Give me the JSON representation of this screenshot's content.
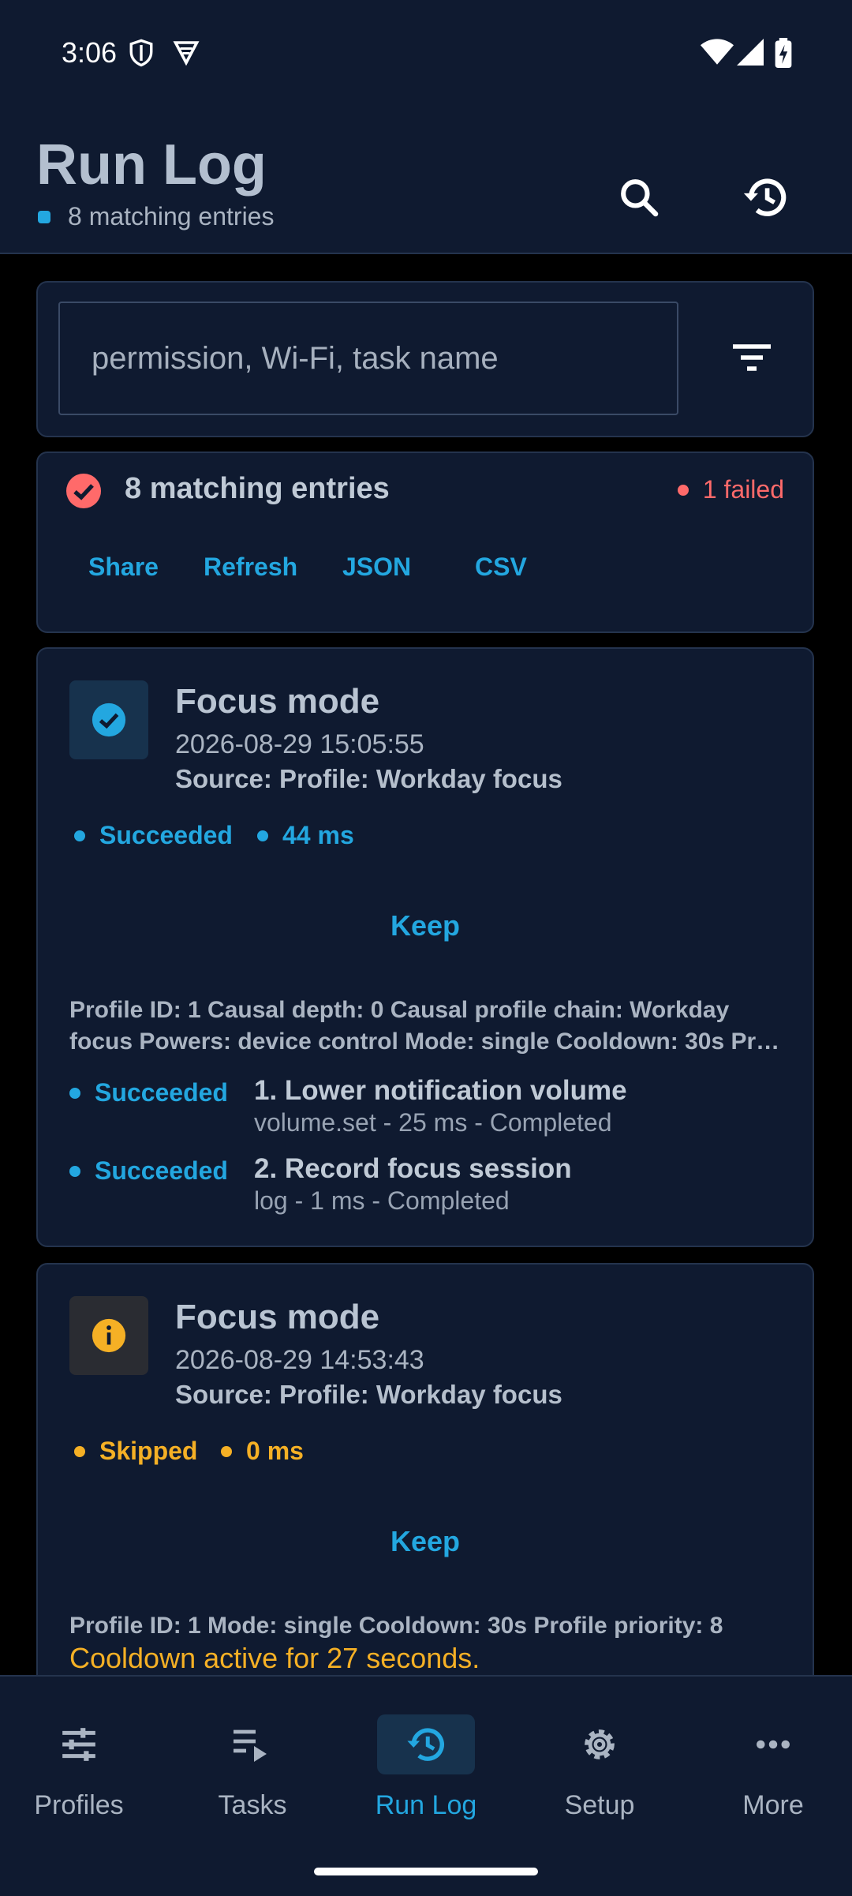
{
  "status_bar": {
    "time": "3:06",
    "icons": [
      "shield-icon",
      "vpn-icon",
      "wifi-icon",
      "signal-icon",
      "battery-icon"
    ]
  },
  "app_bar": {
    "title": "Run Log",
    "subtitle": "8 matching entries",
    "actions": [
      "search-icon",
      "history-icon"
    ]
  },
  "search": {
    "placeholder": "permission, Wi-Fi, task name",
    "value": ""
  },
  "summary": {
    "title": "8 matching entries",
    "failed": "1 failed",
    "actions": [
      "Share",
      "Refresh",
      "JSON",
      "CSV"
    ]
  },
  "entries": [
    {
      "title": "Focus mode",
      "datetime": "2026-08-29 15:05:55",
      "source": "Source: Profile: Workday focus",
      "status": "Succeeded",
      "duration": "44 ms",
      "keep_label": "Keep",
      "details_line1": "Profile ID: 1  Causal depth: 0  Causal profile chain: Workday",
      "details_line2": "focus  Powers: device control  Mode: single  Cooldown: 30s  Pr…",
      "steps": [
        {
          "status": "Succeeded",
          "title": "1. Lower notification volume",
          "sub": "volume.set - 25 ms - Completed"
        },
        {
          "status": "Succeeded",
          "title": "2. Record focus session",
          "sub": "log - 1 ms - Completed"
        }
      ]
    },
    {
      "title": "Focus mode",
      "datetime": "2026-08-29 14:53:43",
      "source": "Source: Profile: Workday focus",
      "status": "Skipped",
      "duration": "0 ms",
      "keep_label": "Keep",
      "details_line1": "Profile ID: 1  Mode: single  Cooldown: 30s  Profile priority: 8",
      "warning": "Cooldown active for 27 seconds."
    }
  ],
  "nav": [
    {
      "label": "Profiles",
      "icon": "sliders-icon"
    },
    {
      "label": "Tasks",
      "icon": "playlist-icon"
    },
    {
      "label": "Run Log",
      "icon": "history-icon",
      "active": true
    },
    {
      "label": "Setup",
      "icon": "gear-icon"
    },
    {
      "label": "More",
      "icon": "more-icon"
    }
  ],
  "colors": {
    "accent": "#23a7e0",
    "failed": "#ff6a6a",
    "skipped": "#f5b025",
    "surface": "#0f1a30"
  }
}
